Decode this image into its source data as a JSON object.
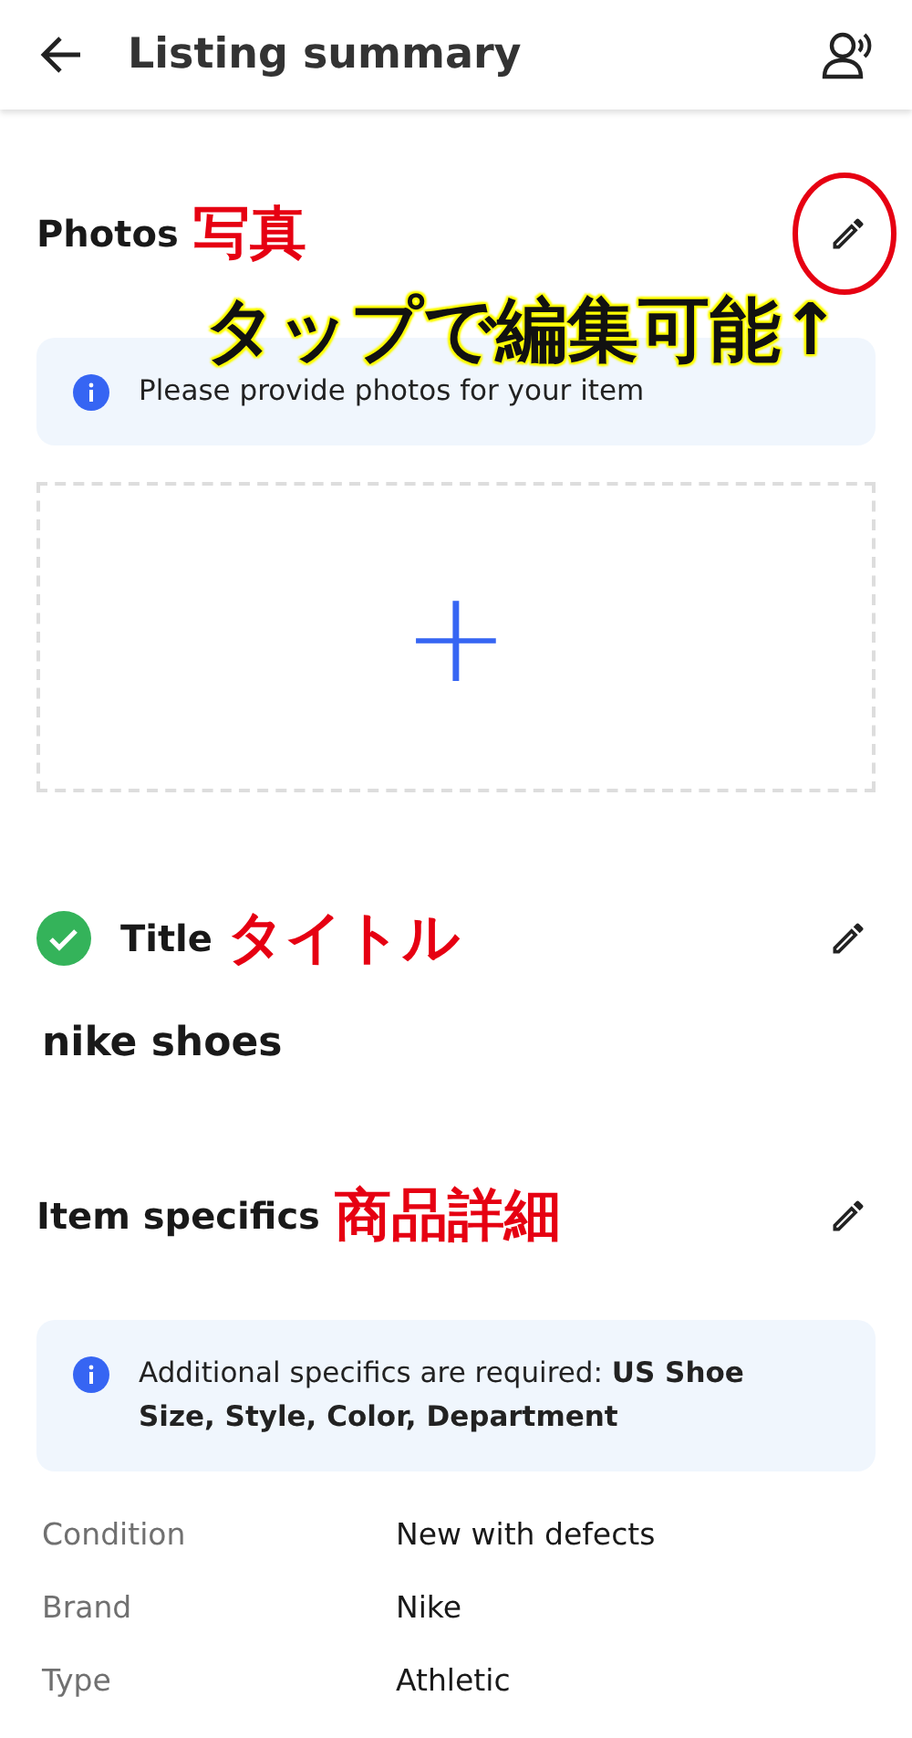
{
  "header": {
    "title": "Listing summary"
  },
  "photos": {
    "heading": "Photos",
    "annotation": "写真",
    "circled": true,
    "hint": "タップで編集可能↑",
    "notice": "Please provide photos for your item",
    "add_label": "+"
  },
  "title_section": {
    "heading": "Title",
    "annotation": "タイトル",
    "complete": true,
    "circled": false,
    "value": "nike shoes"
  },
  "specifics": {
    "heading": "Item specifics",
    "annotation": "商品詳細",
    "circled": false,
    "notice": "Additional specifics are required: **US Shoe Size, Style, Color, Department**",
    "rows": [
      {
        "label": "Condition",
        "value": "New with defects"
      },
      {
        "label": "Brand",
        "value": "Nike"
      },
      {
        "label": "Type",
        "value": "Athletic"
      }
    ]
  }
}
